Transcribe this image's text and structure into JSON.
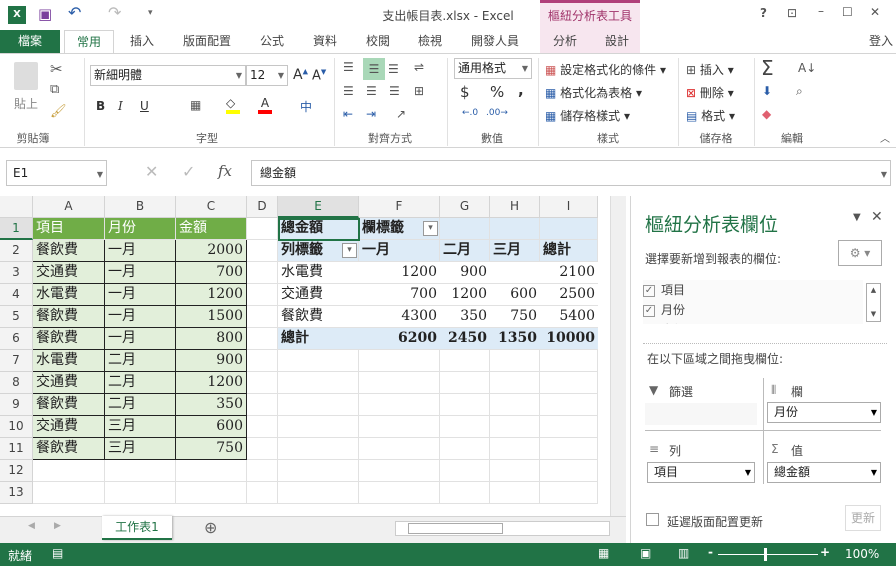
{
  "window": {
    "title": "支出帳目表.xlsx - Excel",
    "context_tab_group": "樞紐分析表工具",
    "help": "?",
    "signin": "登入"
  },
  "tabs": [
    "檔案",
    "常用",
    "插入",
    "版面配置",
    "公式",
    "資料",
    "校閱",
    "檢視",
    "開發人員",
    "分析",
    "設計"
  ],
  "ribbon": {
    "clipboard": {
      "paste": "貼上",
      "label": "剪貼簿"
    },
    "font": {
      "name": "新細明體",
      "size": "12",
      "label": "字型",
      "bold": "B",
      "italic": "I",
      "underline": "U",
      "fill_color": "#ffff00",
      "font_color": "#ff0000"
    },
    "alignment": {
      "label": "對齊方式"
    },
    "number": {
      "format": "通用格式",
      "currency": "$",
      "percent": "%",
      "comma": ",",
      "label": "數值"
    },
    "styles": {
      "items": [
        "設定格式化的條件",
        "格式化為表格",
        "儲存格樣式"
      ],
      "label": "樣式"
    },
    "cells": {
      "items": [
        "插入",
        "刪除",
        "格式"
      ],
      "label": "儲存格"
    },
    "editing": {
      "label": "編輯"
    }
  },
  "formula_bar": {
    "name_box": "E1",
    "formula": "總金額",
    "fx": "fx"
  },
  "columns": [
    "A",
    "B",
    "C",
    "D",
    "E",
    "F",
    "G",
    "H",
    "I"
  ],
  "rows": [
    "1",
    "2",
    "3",
    "4",
    "5",
    "6",
    "7",
    "8",
    "9",
    "10",
    "11",
    "12",
    "13"
  ],
  "grid": [
    [
      "項目",
      "月份",
      "金額",
      "",
      "總金額",
      "欄標籤",
      "",
      "",
      ""
    ],
    [
      "餐飲費",
      "一月",
      "2000",
      "",
      "列標籤",
      "一月",
      "二月",
      "三月",
      "總計"
    ],
    [
      "交通費",
      "一月",
      "700",
      "",
      "水電費",
      "1200",
      "900",
      "",
      "2100"
    ],
    [
      "水電費",
      "一月",
      "1200",
      "",
      "交通費",
      "700",
      "1200",
      "600",
      "2500"
    ],
    [
      "餐飲費",
      "一月",
      "1500",
      "",
      "餐飲費",
      "4300",
      "350",
      "750",
      "5400"
    ],
    [
      "餐飲費",
      "一月",
      "800",
      "",
      "總計",
      "6200",
      "2450",
      "1350",
      "10000"
    ],
    [
      "水電費",
      "二月",
      "900",
      "",
      "",
      "",
      "",
      "",
      ""
    ],
    [
      "交通費",
      "二月",
      "1200",
      "",
      "",
      "",
      "",
      "",
      ""
    ],
    [
      "餐飲費",
      "二月",
      "350",
      "",
      "",
      "",
      "",
      "",
      ""
    ],
    [
      "交通費",
      "三月",
      "600",
      "",
      "",
      "",
      "",
      "",
      ""
    ],
    [
      "餐飲費",
      "三月",
      "750",
      "",
      "",
      "",
      "",
      "",
      ""
    ],
    [
      "",
      "",
      "",
      "",
      "",
      "",
      "",
      "",
      ""
    ],
    [
      "",
      "",
      "",
      "",
      "",
      "",
      "",
      "",
      ""
    ]
  ],
  "sheet_tabs": [
    "工作表1"
  ],
  "status": {
    "ready": "就緒",
    "zoom": "100%"
  },
  "pivot_pane": {
    "title": "樞紐分析表欄位",
    "choose": "選擇要新增到報表的欄位:",
    "fields": [
      {
        "name": "項目",
        "checked": true
      },
      {
        "name": "月份",
        "checked": true
      },
      {
        "name": "金額",
        "checked": true
      }
    ],
    "drag": "在以下區域之間拖曳欄位:",
    "filters": "篩選",
    "columns": "欄",
    "rows": "列",
    "values": "值",
    "columns_item": "月份",
    "rows_item": "項目",
    "values_item": "總金額",
    "defer": "延遲版面配置更新",
    "update": "更新"
  }
}
